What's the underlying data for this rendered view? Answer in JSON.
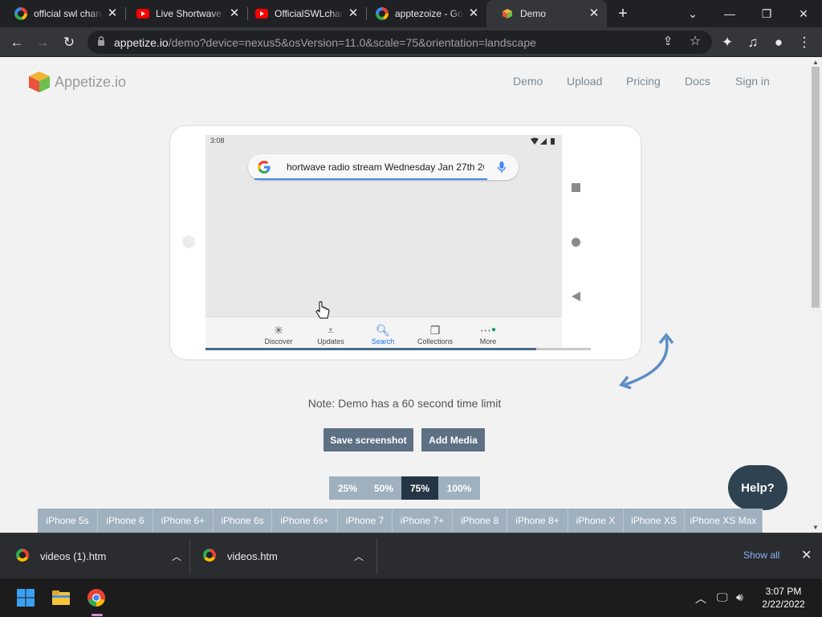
{
  "browser": {
    "tabs": [
      {
        "title": "official swl channel",
        "favicon": "google-icon",
        "active": false
      },
      {
        "title": "Live Shortwave",
        "favicon": "youtube-icon",
        "active": false
      },
      {
        "title": "OfficialSWLchannel",
        "favicon": "youtube-icon",
        "active": false
      },
      {
        "title": "apptezoize - Google",
        "favicon": "google-icon",
        "active": false
      },
      {
        "title": "Demo",
        "favicon": "appetize-cube-icon",
        "active": true
      }
    ],
    "url_host": "appetize.io",
    "url_path": "/demo?device=nexus5&osVersion=11.0&scale=75&orientation=landscape"
  },
  "site": {
    "logo_text": "Appetize.io",
    "nav": [
      "Demo",
      "Upload",
      "Pricing",
      "Docs",
      "Sign in"
    ]
  },
  "emulator": {
    "status_time": "3:08",
    "search_query": "hortwave radio stream Wednesday Jan 27th 20",
    "bottom_nav": [
      {
        "label": "Discover",
        "icon": "asterisk-icon",
        "selected": false
      },
      {
        "label": "Updates",
        "icon": "updates-icon",
        "selected": false
      },
      {
        "label": "Search",
        "icon": "search-icon",
        "selected": true
      },
      {
        "label": "Collections",
        "icon": "collections-icon",
        "selected": false
      },
      {
        "label": "More",
        "icon": "more-icon",
        "selected": false
      }
    ]
  },
  "note": "Note: Demo has a 60 second time limit",
  "buttons": {
    "save_screenshot": "Save screenshot",
    "add_media": "Add Media"
  },
  "scales": [
    {
      "label": "25%",
      "selected": false
    },
    {
      "label": "50%",
      "selected": false
    },
    {
      "label": "75%",
      "selected": true
    },
    {
      "label": "100%",
      "selected": false
    }
  ],
  "help_label": "Help?",
  "devices": [
    "iPhone 5s",
    "iPhone 6",
    "iPhone 6+",
    "iPhone 6s",
    "iPhone 6s+",
    "iPhone 7",
    "iPhone 7+",
    "iPhone 8",
    "iPhone 8+",
    "iPhone X",
    "iPhone XS",
    "iPhone XS Max"
  ],
  "downloads": {
    "items": [
      "videos (1).htm",
      "videos.htm"
    ],
    "show_all": "Show all"
  },
  "taskbar": {
    "time": "3:07 PM",
    "date": "2/22/2022"
  },
  "colors": {
    "accent": "#5d7084",
    "scale_selected": "#243645",
    "device_button": "#9fb0bf",
    "help_button": "#2f4252"
  }
}
